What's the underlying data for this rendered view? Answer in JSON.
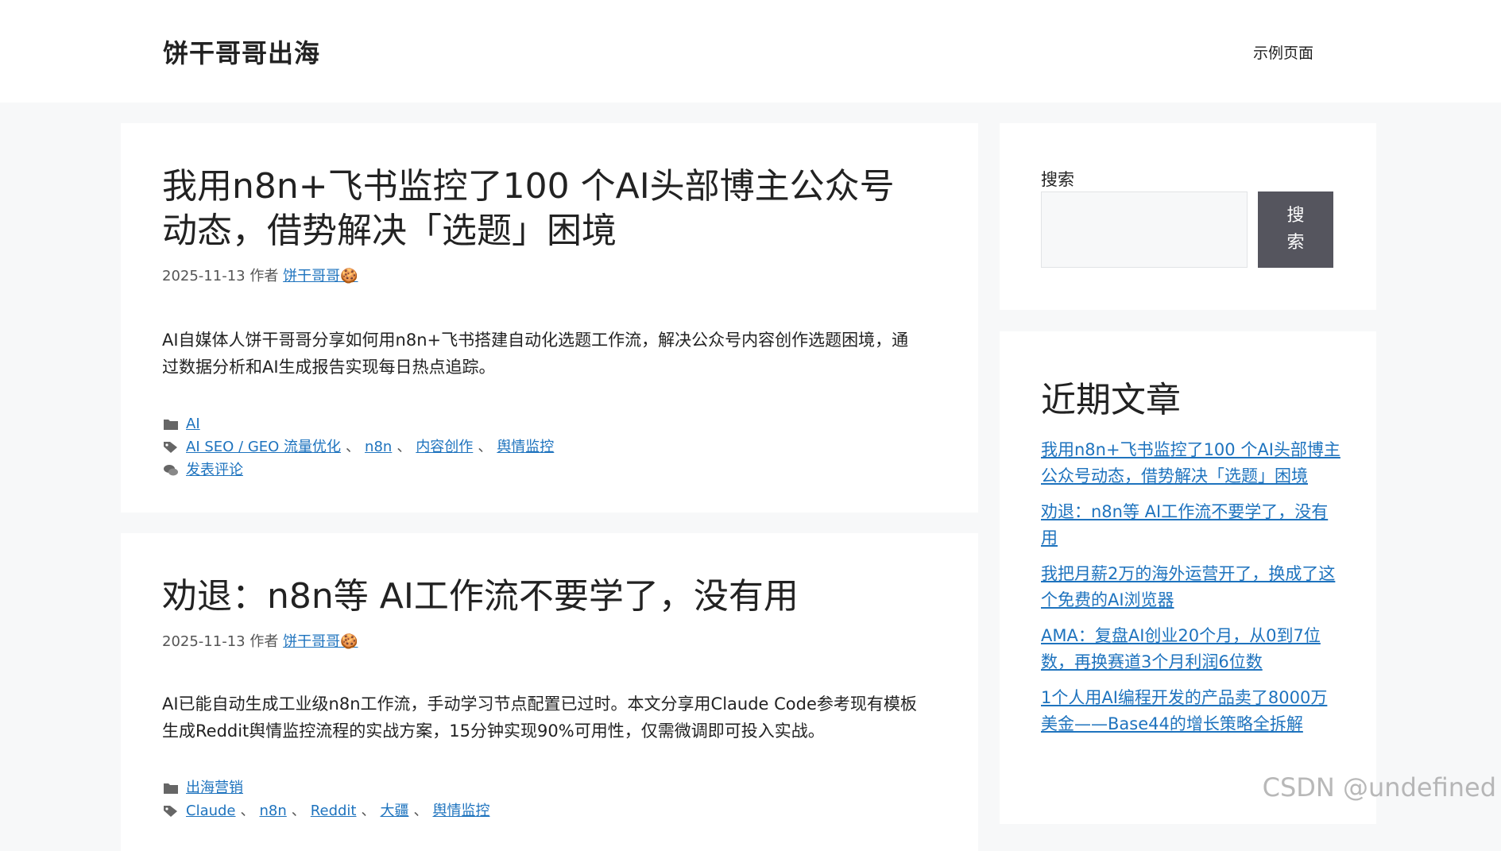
{
  "header": {
    "site_title": "饼干哥哥出海",
    "nav": {
      "sample_page": "示例页面"
    }
  },
  "articles": [
    {
      "title": "我用n8n+飞书监控了100 个AI头部博主公众号动态，借势解决「选题」困境",
      "date": "2025-11-13",
      "by": "作者",
      "author": "饼干哥哥🍪",
      "summary": "AI自媒体人饼干哥哥分享如何用n8n+飞书搭建自动化选题工作流，解决公众号内容创作选题困境，通过数据分析和AI生成报告实现每日热点追踪。",
      "categories": [
        "AI"
      ],
      "tags": [
        "AI SEO / GEO 流量优化",
        "n8n",
        "内容创作",
        "舆情监控"
      ],
      "comment_link": "发表评论"
    },
    {
      "title": "劝退：n8n等 AI工作流不要学了，没有用",
      "date": "2025-11-13",
      "by": "作者",
      "author": "饼干哥哥🍪",
      "summary": "AI已能自动生成工业级n8n工作流，手动学习节点配置已过时。本文分享用Claude Code参考现有模板生成Reddit舆情监控流程的实战方案，15分钟实现90%可用性，仅需微调即可投入实战。",
      "categories": [
        "出海营销"
      ],
      "tags": [
        "Claude",
        "n8n",
        "Reddit",
        "大疆",
        "舆情监控"
      ]
    }
  ],
  "tag_separator": "、",
  "sidebar": {
    "search": {
      "label": "搜索",
      "button": "搜索",
      "value": ""
    },
    "recent": {
      "title": "近期文章",
      "items": [
        "我用n8n+飞书监控了100 个AI头部博主公众号动态，借势解决「选题」困境",
        "劝退：n8n等 AI工作流不要学了，没有用",
        "我把月薪2万的海外运营开了，换成了这个免费的AI浏览器",
        "AMA：复盘AI创业20个月，从0到7位数，再换赛道3个月利润6位数",
        "1个人用AI编程开发的产品卖了8000万美金——Base44的增长策略全拆解"
      ]
    }
  },
  "watermark": "CSDN @undefined",
  "colors": {
    "link": "#1e73be",
    "button": "#55555e",
    "background": "#f7f8f9"
  },
  "icons": {
    "category": "folder-icon",
    "tag": "tag-icon",
    "comment": "comment-icon"
  }
}
